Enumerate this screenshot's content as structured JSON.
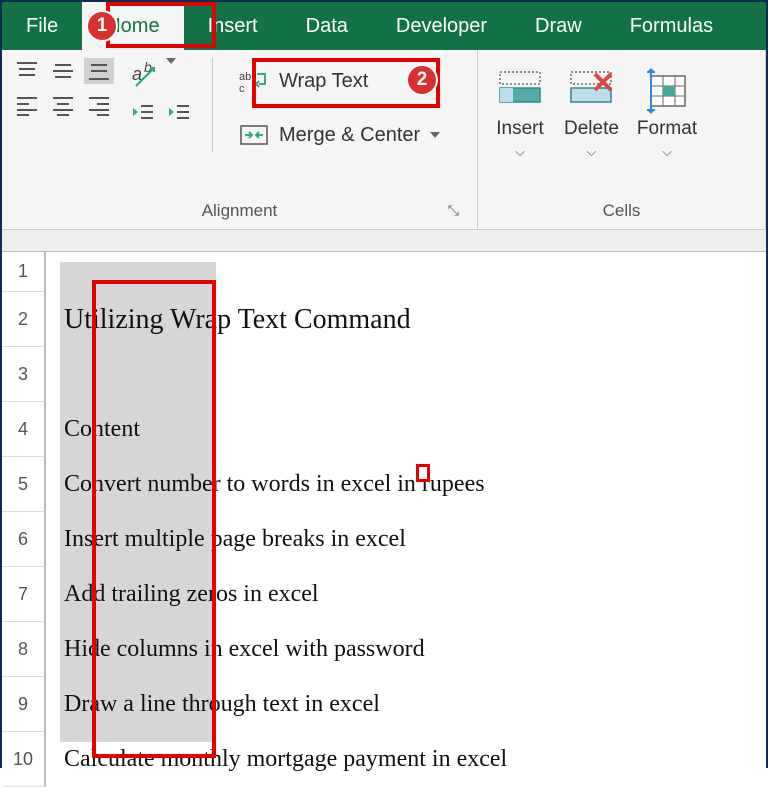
{
  "tabs": {
    "file": "File",
    "home": "Home",
    "insert": "Insert",
    "data": "Data",
    "developer": "Developer",
    "draw": "Draw",
    "formulas": "Formulas"
  },
  "alignment": {
    "label": "Alignment",
    "wrap": "Wrap Text",
    "merge": "Merge & Center"
  },
  "cells": {
    "label": "Cells",
    "insert": "Insert",
    "delete": "Delete",
    "format": "Format"
  },
  "rows": [
    "1",
    "2",
    "3",
    "4",
    "5",
    "6",
    "7",
    "8",
    "9",
    "10"
  ],
  "content": {
    "title": "Utilizing Wrap Text Command",
    "r4": "Content",
    "r5": "Convert number to words in excel in rupees",
    "r6": "Insert multiple page breaks in excel",
    "r7": "Add trailing zeros in excel",
    "r8": "Hide columns in excel with password",
    "r9": "Draw a line through text in excel",
    "r10": "Calculate monthly mortgage payment in excel"
  },
  "badges": {
    "one": "1",
    "two": "2"
  }
}
